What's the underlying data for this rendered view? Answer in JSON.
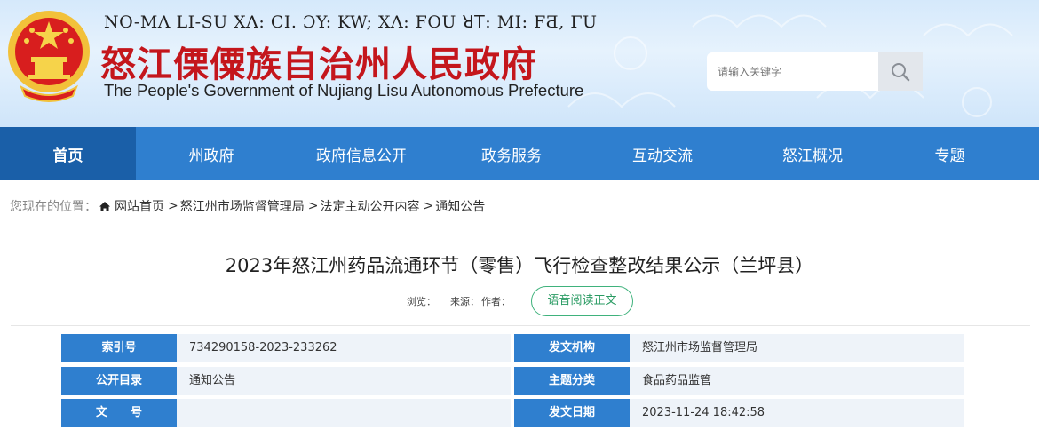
{
  "header": {
    "lisu_title": "NO-MΛ LI-SU XΛ: CI. ƆY: KW; XΛ: FOU ꓤꓔ: MI: FƋ, ΓU",
    "cn_title": "怒江傈僳族自治州人民政府",
    "en_title": "The People's Government of Nujiang Lisu Autonomous Prefecture",
    "emblem_icon": "national-emblem-icon",
    "colors": {
      "title_red": "#c4161c",
      "nav_blue": "#2f7fcf",
      "nav_active": "#1a5fa8"
    }
  },
  "search": {
    "placeholder": "请输入关键字",
    "icon": "search-icon"
  },
  "nav": {
    "items": [
      {
        "label": "首页",
        "active": true
      },
      {
        "label": "州政府"
      },
      {
        "label": "政府信息公开"
      },
      {
        "label": "政务服务"
      },
      {
        "label": "互动交流"
      },
      {
        "label": "怒江概况"
      },
      {
        "label": "专题"
      }
    ]
  },
  "breadcrumb": {
    "prefix": "您现在的位置：",
    "home_icon": "home-icon",
    "items": [
      "网站首页",
      "怒江州市场监督管理局",
      "法定主动公开内容",
      "通知公告"
    ],
    "separator": ">"
  },
  "article": {
    "title": "2023年怒江州药品流通环节（零售）飞行检查整改结果公示（兰坪县）",
    "views_label": "浏览：",
    "source_label": "来源：",
    "author_label": "作者：",
    "voice_button": "语音阅读正文"
  },
  "info": {
    "rows": [
      {
        "k1": "索引号",
        "v1": "734290158-2023-233262",
        "k2": "发文机构",
        "v2": "怒江州市场监督管理局"
      },
      {
        "k1": "公开目录",
        "v1": "通知公告",
        "k2": "主题分类",
        "v2": "食品药品监管"
      },
      {
        "k1": "文　　号",
        "v1": "",
        "k2": "发文日期",
        "v2": "2023-11-24 18:42:58"
      }
    ]
  }
}
